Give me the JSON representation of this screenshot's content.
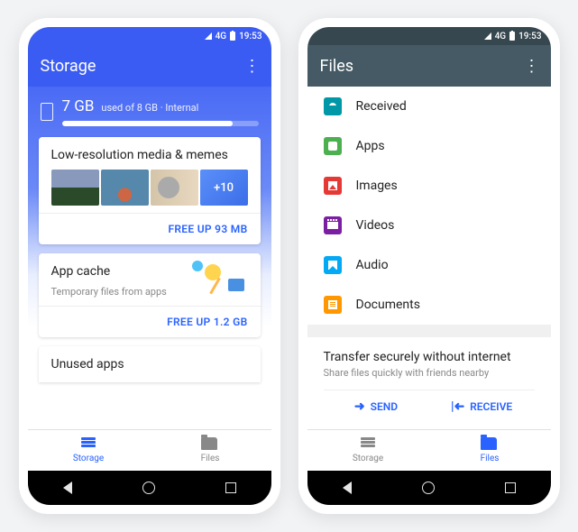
{
  "status": {
    "network": "4G",
    "time": "19:53"
  },
  "p1": {
    "title": "Storage",
    "used": "7 GB",
    "used_label": "used of 8 GB · Internal",
    "progress_pct": 87,
    "card_media": {
      "title": "Low-resolution media & memes",
      "more": "+10",
      "action": "FREE UP 93 MB"
    },
    "card_cache": {
      "title": "App cache",
      "sub": "Temporary files from apps",
      "action": "FREE UP 1.2 GB"
    },
    "card_peek": "Unused apps",
    "nav": {
      "storage": "Storage",
      "files": "Files"
    }
  },
  "p2": {
    "title": "Files",
    "cats": [
      "Received",
      "Apps",
      "Images",
      "Videos",
      "Audio",
      "Documents"
    ],
    "transfer": {
      "title": "Transfer securely without internet",
      "sub": "Share files quickly with friends nearby",
      "send": "SEND",
      "receive": "RECEIVE"
    },
    "nav": {
      "storage": "Storage",
      "files": "Files"
    }
  }
}
